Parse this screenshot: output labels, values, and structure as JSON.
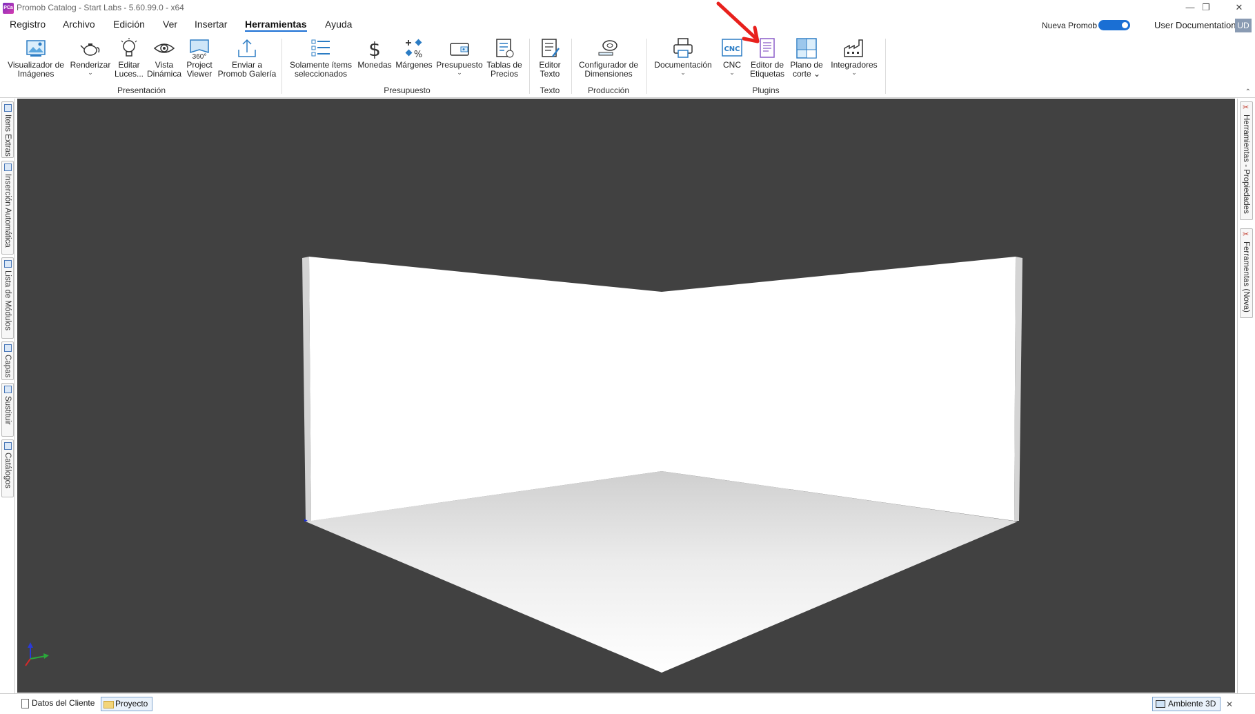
{
  "window": {
    "title": "Promob Catalog - Start Labs - 5.60.99.0 - x64",
    "app_icon_text": "PCa",
    "minimize": "—",
    "restore": "❐",
    "close": "✕"
  },
  "menu": {
    "items": [
      "Registro",
      "Archivo",
      "Edición",
      "Ver",
      "Insertar",
      "Herramientas",
      "Ayuda"
    ],
    "active": "Herramientas",
    "nueva_promob_label": "Nueva Promob",
    "nueva_promob_on": true,
    "user_documentation": "User Documentation",
    "user_initials": "UD"
  },
  "ribbon": {
    "buttons": [
      {
        "l1": "Visualizador de",
        "l2": "Imágenes",
        "icon": "image-viewer-icon"
      },
      {
        "l1": "Renderizar",
        "l2": "⌄",
        "icon": "teapot-icon"
      },
      {
        "l1": "Editar",
        "l2": "Luces...",
        "icon": "lightbulb-icon"
      },
      {
        "l1": "Vista",
        "l2": "Dinámica",
        "icon": "eye-icon"
      },
      {
        "l1": "Project",
        "l2": "Viewer",
        "icon": "360-icon"
      },
      {
        "l1": "Enviar a",
        "l2": "Promob Galería",
        "icon": "upload-icon"
      },
      {
        "l1": "Solamente ítems",
        "l2": "seleccionados",
        "icon": "checklist-icon"
      },
      {
        "l1": "Monedas",
        "l2": "",
        "icon": "dollar-icon"
      },
      {
        "l1": "Márgenes",
        "l2": "",
        "icon": "percent-icon"
      },
      {
        "l1": "Presupuesto",
        "l2": "⌄",
        "icon": "wallet-icon"
      },
      {
        "l1": "Tablas de",
        "l2": "Precios",
        "icon": "price-table-icon"
      },
      {
        "l1": "Editor",
        "l2": "Texto",
        "icon": "text-editor-icon"
      },
      {
        "l1": "Configurador de",
        "l2": "Dimensiones",
        "icon": "tape-measure-icon"
      },
      {
        "l1": "Documentación",
        "l2": "⌄",
        "icon": "printer-icon"
      },
      {
        "l1": "CNC",
        "l2": "⌄",
        "icon": "cnc-icon"
      },
      {
        "l1": "Editor de",
        "l2": "Etiquetas",
        "icon": "label-editor-icon"
      },
      {
        "l1": "Plano de",
        "l2": "corte ⌄",
        "icon": "cut-plan-icon"
      },
      {
        "l1": "Integradores",
        "l2": "⌄",
        "icon": "factory-icon"
      }
    ],
    "groups": [
      "Presentación",
      "Presupuesto",
      "Texto",
      "Producción",
      "Plugins"
    ],
    "cnc_text": "CNC",
    "p360_text": "360°",
    "collapse": "⌃"
  },
  "left_tabs": [
    "Itens Extras",
    "Inserción Automática",
    "Lista de Módulos",
    "Capas",
    "Sustituir",
    "Catálogos"
  ],
  "right_tabs": [
    "Herramientas - Propiedades",
    "Ferramentas (Nova)"
  ],
  "statusbar": {
    "tabs": [
      "Datos del Cliente",
      "Proyecto"
    ],
    "active_tab": "Proyecto",
    "view_label": "Ambiente 3D",
    "close": "✕"
  },
  "colors": {
    "viewport_bg": "#414141",
    "accent": "#1a6fd4",
    "annotation_arrow": "#e8201c"
  }
}
